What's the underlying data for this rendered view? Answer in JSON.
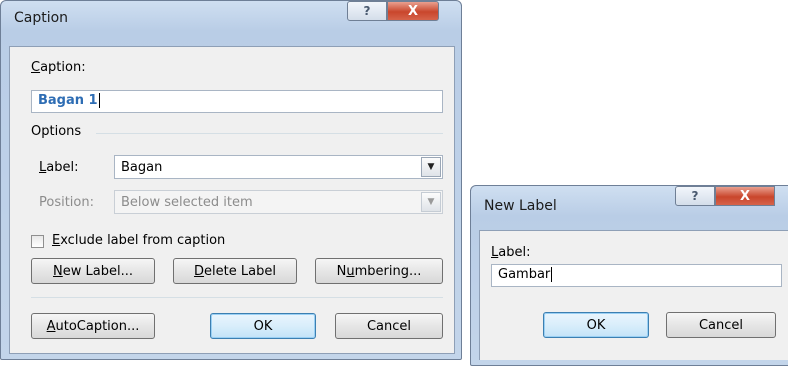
{
  "caption_dialog": {
    "title": "Caption",
    "help_glyph": "?",
    "close_glyph": "X",
    "caption_label_first": "C",
    "caption_label_rest": "aption:",
    "caption_value": "Bagan 1",
    "options_heading": "Options",
    "label_label_first": "L",
    "label_label_rest": "abel:",
    "label_value": "Bagan",
    "position_label": "Position:",
    "position_value": "Below selected item",
    "exclude_first": "E",
    "exclude_rest": "xclude label from caption",
    "exclude_checked": false,
    "new_label_first": "N",
    "new_label_rest": "ew Label...",
    "delete_label_first": "D",
    "delete_label_rest": "elete Label",
    "numbering_pre": "N",
    "numbering_u": "u",
    "numbering_rest": "mbering...",
    "autocaption_first": "A",
    "autocaption_rest": "utoCaption...",
    "ok_label": "OK",
    "cancel_label": "Cancel"
  },
  "new_label_dialog": {
    "title": "New Label",
    "help_glyph": "?",
    "close_glyph": "X",
    "label_first": "L",
    "label_rest": "abel:",
    "label_value": "Gambar",
    "ok_label": "OK",
    "cancel_label": "Cancel"
  },
  "icons": {
    "help": "help-icon",
    "close": "close-icon",
    "dropdown": "chevron-down-icon"
  },
  "colors": {
    "title_bar": "#c3d5ea",
    "close_button": "#c9462c",
    "caption_text": "#2e6db4",
    "default_button_border": "#3c7fb1"
  }
}
